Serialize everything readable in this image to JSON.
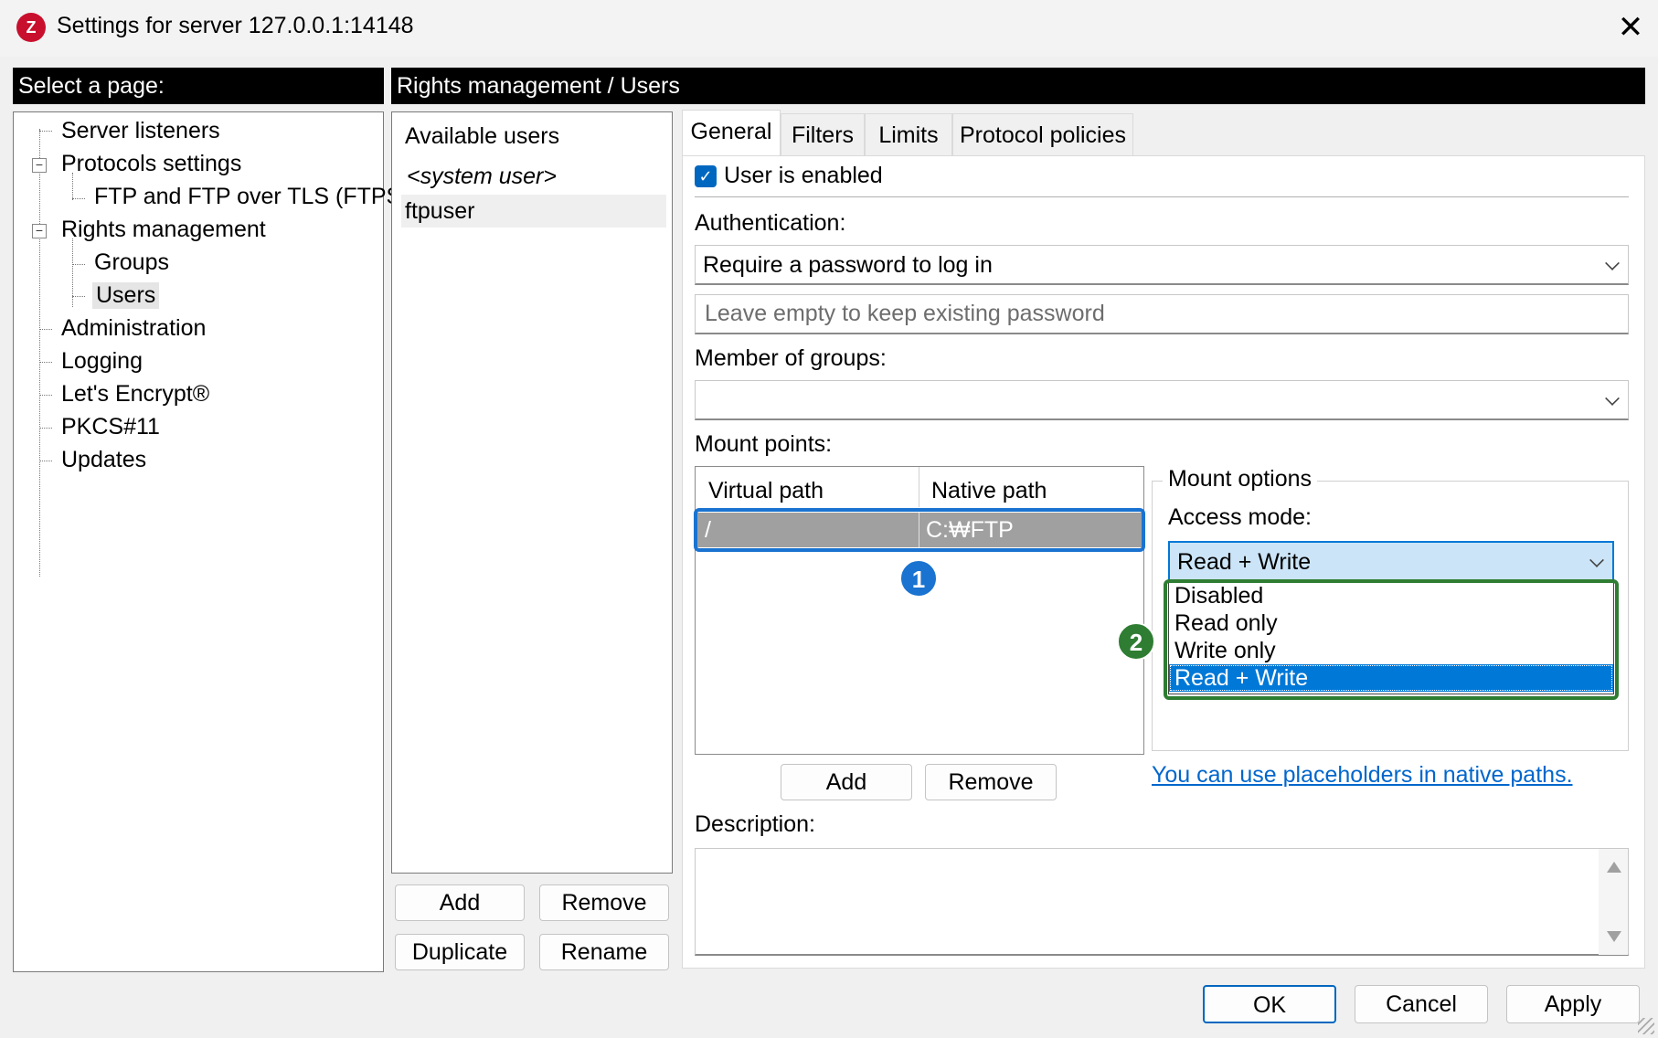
{
  "window": {
    "title": "Settings for server 127.0.0.1:14148",
    "app_icon": "filezilla-server-icon",
    "close_glyph": "✕"
  },
  "left_header": "Select a page:",
  "tree": {
    "items": [
      {
        "label": "Server listeners"
      },
      {
        "label": "Protocols settings",
        "expander": "−"
      },
      {
        "label": "FTP and FTP over TLS (FTPS)"
      },
      {
        "label": "Rights management",
        "expander": "−"
      },
      {
        "label": "Groups"
      },
      {
        "label": "Users"
      },
      {
        "label": "Administration"
      },
      {
        "label": "Logging"
      },
      {
        "label": "Let's Encrypt®"
      },
      {
        "label": "PKCS#11"
      },
      {
        "label": "Updates"
      }
    ]
  },
  "right_header": "Rights management / Users",
  "users": {
    "header": "Available users",
    "items": [
      "<system user>",
      "ftpuser"
    ],
    "buttons": {
      "add": "Add",
      "remove": "Remove",
      "duplicate": "Duplicate",
      "rename": "Rename"
    }
  },
  "tabs": [
    "General",
    "Filters",
    "Limits",
    "Protocol policies"
  ],
  "general": {
    "user_enabled_label": "User is enabled",
    "user_enabled": true,
    "auth_label": "Authentication:",
    "auth_value": "Require a password to log in",
    "password_placeholder": "Leave empty to keep existing password",
    "groups_label": "Member of groups:",
    "groups_value": "",
    "mount_points_label": "Mount points:",
    "mount_columns": [
      "Virtual path",
      "Native path"
    ],
    "mount_rows": [
      {
        "virtual": "/",
        "native": "C:₩FTP"
      }
    ],
    "mount_add": "Add",
    "mount_remove": "Remove",
    "mount_options_label": "Mount options",
    "access_mode_label": "Access mode:",
    "access_mode_value": "Read + Write",
    "access_mode_options": [
      "Disabled",
      "Read only",
      "Write only",
      "Read + Write"
    ],
    "placeholders_link": "You can use placeholders in native paths.",
    "description_label": "Description:"
  },
  "annotations": {
    "badge1": "1",
    "badge2": "2",
    "blue": "#1a73d0",
    "green": "#2e7d32"
  },
  "footer": {
    "ok": "OK",
    "cancel": "Cancel",
    "apply": "Apply"
  },
  "colors": {
    "selection": "#0078d7",
    "link": "#0066cc",
    "selected_row": "#a0a0a0"
  }
}
